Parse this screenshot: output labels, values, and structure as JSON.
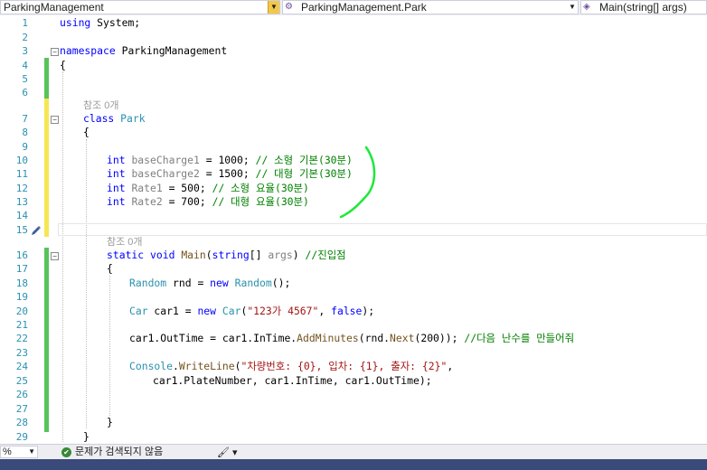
{
  "navbar": {
    "project": "ParkingManagement",
    "type": "ParkingManagement.Park",
    "member": "Main(string[] args)"
  },
  "line_numbers": [
    "1",
    "2",
    "3",
    "4",
    "5",
    "6",
    "7",
    "8",
    "9",
    "10",
    "11",
    "12",
    "13",
    "14",
    "15",
    "16",
    "17",
    "18",
    "19",
    "20",
    "21",
    "22",
    "23",
    "24",
    "25",
    "26",
    "27",
    "28",
    "29"
  ],
  "code": {
    "l1_kw": "using",
    "l1_rest": " System;",
    "l3_kw": "namespace",
    "l3_rest": " ParkingManagement",
    "l4": "{",
    "lens1": "참조 0개",
    "l7_kw": "class",
    "l7_type": "Park",
    "l8": "{",
    "l10_kw": "int",
    "l10_name": "baseCharge1",
    "l10_val": " = 1000; ",
    "l10_cm": "// 소형 기본(30분)",
    "l11_kw": "int",
    "l11_name": "baseCharge2",
    "l11_val": " = 1500; ",
    "l11_cm": "// 대형 기본(30분)",
    "l12_kw": "int",
    "l12_name": "Rate1",
    "l12_val": " = 500; ",
    "l12_cm": "// 소형 요율(30분)",
    "l13_kw": "int",
    "l13_name": "Rate2",
    "l13_val": " = 700; ",
    "l13_cm": "// 대형 요율(30분)",
    "lens2": "참조 0개",
    "l16_kw1": "static",
    "l16_kw2": "void",
    "l16_fn": "Main",
    "l16_p1": "(",
    "l16_kw3": "string",
    "l16_p2": "[] ",
    "l16_arg": "args",
    "l16_p3": ") ",
    "l16_cm": "//진입점",
    "l17": "{",
    "l18_ty1": "Random",
    "l18_a": " rnd = ",
    "l18_kw": "new",
    "l18_ty2": "Random",
    "l18_b": "();",
    "l20_ty1": "Car",
    "l20_a": " car1 = ",
    "l20_kw": "new",
    "l20_ty2": "Car",
    "l20_b": "(",
    "l20_str": "\"123가 4567\"",
    "l20_c": ", ",
    "l20_kw2": "false",
    "l20_d": ");",
    "l22_a": "car1.OutTime = car1.InTime.",
    "l22_fn": "AddMinutes",
    "l22_b": "(rnd.",
    "l22_fn2": "Next",
    "l22_c": "(200)); ",
    "l22_cm": "//다음 난수를 만들어줘",
    "l24_ty": "Console",
    "l24_a": ".",
    "l24_fn": "WriteLine",
    "l24_b": "(",
    "l24_str": "\"차량번호: {0}, 입차: {1}, 출자: {2}\"",
    "l24_c": ",",
    "l25": "car1.PlateNumber, car1.InTime, car1.OutTime);",
    "l28": "}",
    "l29": "}"
  },
  "statusbar": {
    "zoom": "%",
    "issues": "문제가 검색되지 않음"
  },
  "icons": {
    "ok": "check-circle-icon",
    "brush": "brush-icon",
    "class_icon": "class-icon",
    "method_icon": "method-icon",
    "pencil": "edit-pencil-icon"
  },
  "colors": {
    "keyword": "#0000ff",
    "type": "#2b91af",
    "string": "#a31515",
    "comment": "#008000",
    "changed_saved": "#57c35a",
    "changed_unsaved": "#f6e652"
  }
}
